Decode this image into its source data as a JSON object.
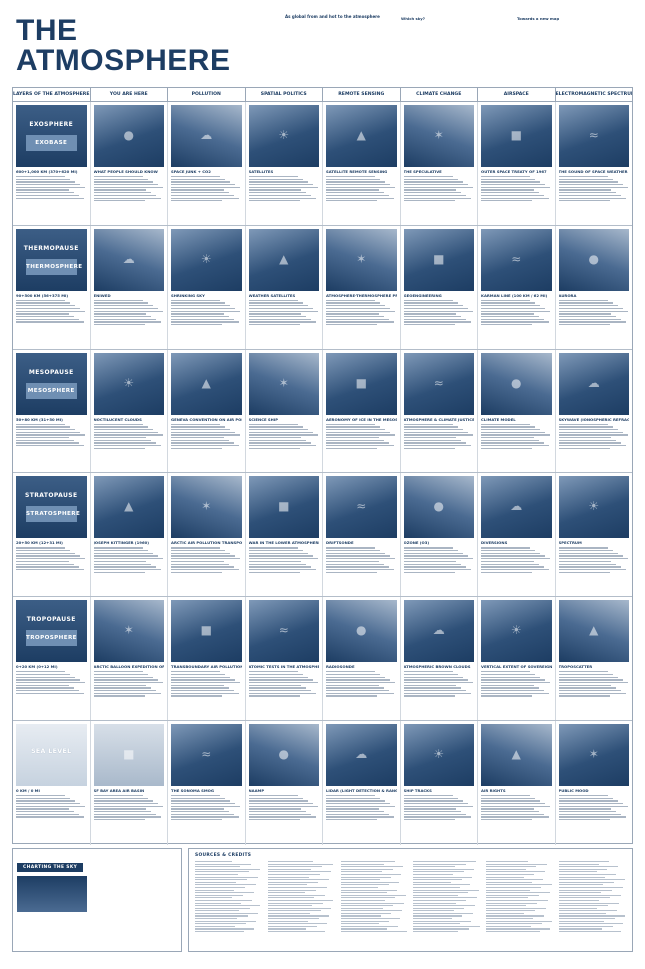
{
  "title": "THE ATMOSPHERE",
  "subtitle": "AS GLOBAL FROM AND HOT TO THE ATMOSPHERE",
  "intro": {
    "lead": "As global from and hot to the atmosphere",
    "q1": "Which sky?",
    "q2": "Towards a new map"
  },
  "columns": [
    "LAYERS OF THE ATMOSPHERE",
    "YOU ARE HERE",
    "POLLUTION",
    "SPATIAL POLITICS",
    "REMOTE SENSING",
    "CLIMATE CHANGE",
    "AIRSPACE",
    "ELECTROMAGNETIC SPECTRUM"
  ],
  "layers": [
    {
      "top": "EXOSPHERE",
      "band": "EXOBASE",
      "caption": "600+1,000 KM (370+620 MI)"
    },
    {
      "top": "THERMOPAUSE",
      "band": "THERMOSPHERE",
      "caption": "90+500 KM (56+375 MI)"
    },
    {
      "top": "MESOPAUSE",
      "band": "MESOSPHERE",
      "caption": "50+80 KM (31+50 MI)"
    },
    {
      "top": "STRATOPAUSE",
      "band": "STRATOSPHERE",
      "caption": "20+50 KM (12+31 MI)"
    },
    {
      "top": "TROPOPAUSE",
      "band": "TROPOSPHERE",
      "caption": "0+20 KM (0+12 MI)"
    },
    {
      "top": "SEA LEVEL",
      "band": "",
      "caption": "0 KM / 0 MI"
    }
  ],
  "rows": [
    [
      "WHAT PEOPLE SHOULD KNOW",
      "SPACE JUNK + CO2",
      "SATELLITES",
      "SATELLITE REMOTE SENSING",
      "THE SPECULATIVE",
      "OUTER SPACE TREATY OF 1967",
      "THE SOUND OF SPACE WEATHER"
    ],
    [
      "ENIWED",
      "SHRINKING SKY",
      "WEATHER SATELLITES",
      "ATMOSPHERE-THERMOSPHERE PROBE",
      "GEOENGINEERING",
      "KARMAN LINE (100 KM / 62 MI)",
      "AURORA"
    ],
    [
      "NOCTILUCENT CLOUDS",
      "GENEVA CONVENTION ON AIR POLLUTION",
      "SCIENCE SHIP",
      "AERONOMY OF ICE IN THE MESOSPHERE",
      "ATMOSPHERE & CLIMATE JUSTICE",
      "CLIMATE MODEL",
      "SKYWAVE (IONOSPHERIC REFRACTION)"
    ],
    [
      "JOSEPH KITTINGER (1960)",
      "ARCTIC AIR POLLUTION TRANSPORT",
      "WAR IN THE LOWER ATMOSPHERE",
      "DRIFTSONDE",
      "OZONE (O3)",
      "DIVERSIONS",
      "SPECTRUM"
    ],
    [
      "ARCTIC BALLOON EXPEDITION OF 1897",
      "TRANSBOUNDARY AIR POLLUTION",
      "ATOMIC TESTS IN THE ATMOSPHERE",
      "RADIOSONDE",
      "ATMOSPHERIC BROWN CLOUDS",
      "VERTICAL EXTENT OF SOVEREIGNTY",
      "TROPOSCATTER"
    ],
    [
      "SF BAY AREA AIR BASIN",
      "THE SONOMA SMOG",
      "NAAMP",
      "LIDAR (LIGHT DETECTION & RANGING)",
      "SHIP TRACKS",
      "AIR RIGHTS",
      "PUBLIC MOOD"
    ]
  ],
  "bottom": {
    "chart_title": "CHARTING THE SKY",
    "sources_title": "SOURCES & CREDITS"
  },
  "icons": {
    "layer": "atmosphere-layer-icon",
    "thumb": "photo-icon"
  },
  "colors": {
    "ink": "#1d3d63",
    "band": "#6f8fb3"
  }
}
